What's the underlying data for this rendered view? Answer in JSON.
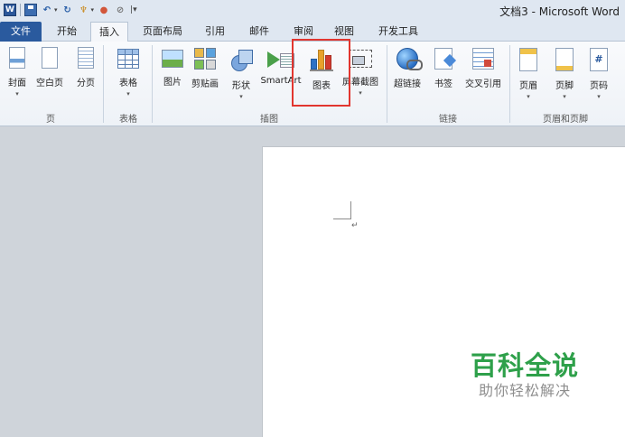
{
  "window": {
    "title": "文档3 - Microsoft Word"
  },
  "quick_access": {
    "customize_glyph": "|▾"
  },
  "tabs": [
    {
      "label": "文件"
    },
    {
      "label": "开始"
    },
    {
      "label": "插入"
    },
    {
      "label": "页面布局"
    },
    {
      "label": "引用"
    },
    {
      "label": "邮件"
    },
    {
      "label": "审阅"
    },
    {
      "label": "视图"
    },
    {
      "label": "开发工具"
    }
  ],
  "ribbon": {
    "groups": {
      "pages": "页",
      "tables": "表格",
      "illustrations": "插图",
      "links": "链接",
      "header_footer": "页眉和页脚"
    },
    "buttons": {
      "cover": "封面",
      "blank_page": "空白页",
      "page_break": "分页",
      "table": "表格",
      "picture": "图片",
      "clip_art": "剪贴画",
      "shapes": "形状",
      "smartart": "SmartArt",
      "chart": "图表",
      "screenshot": "屏幕截图",
      "hyperlink": "超链接",
      "bookmark": "书签",
      "cross_reference": "交叉引用",
      "header": "页眉",
      "footer": "页脚",
      "page_number": "页码",
      "page_number_glyph": "#"
    },
    "highlight_color": "#e2362f"
  },
  "document": {
    "paragraph_mark": "↵"
  },
  "watermark": {
    "title": "百科全说",
    "subtitle": "助你轻松解决",
    "color": "#2ea04a"
  }
}
